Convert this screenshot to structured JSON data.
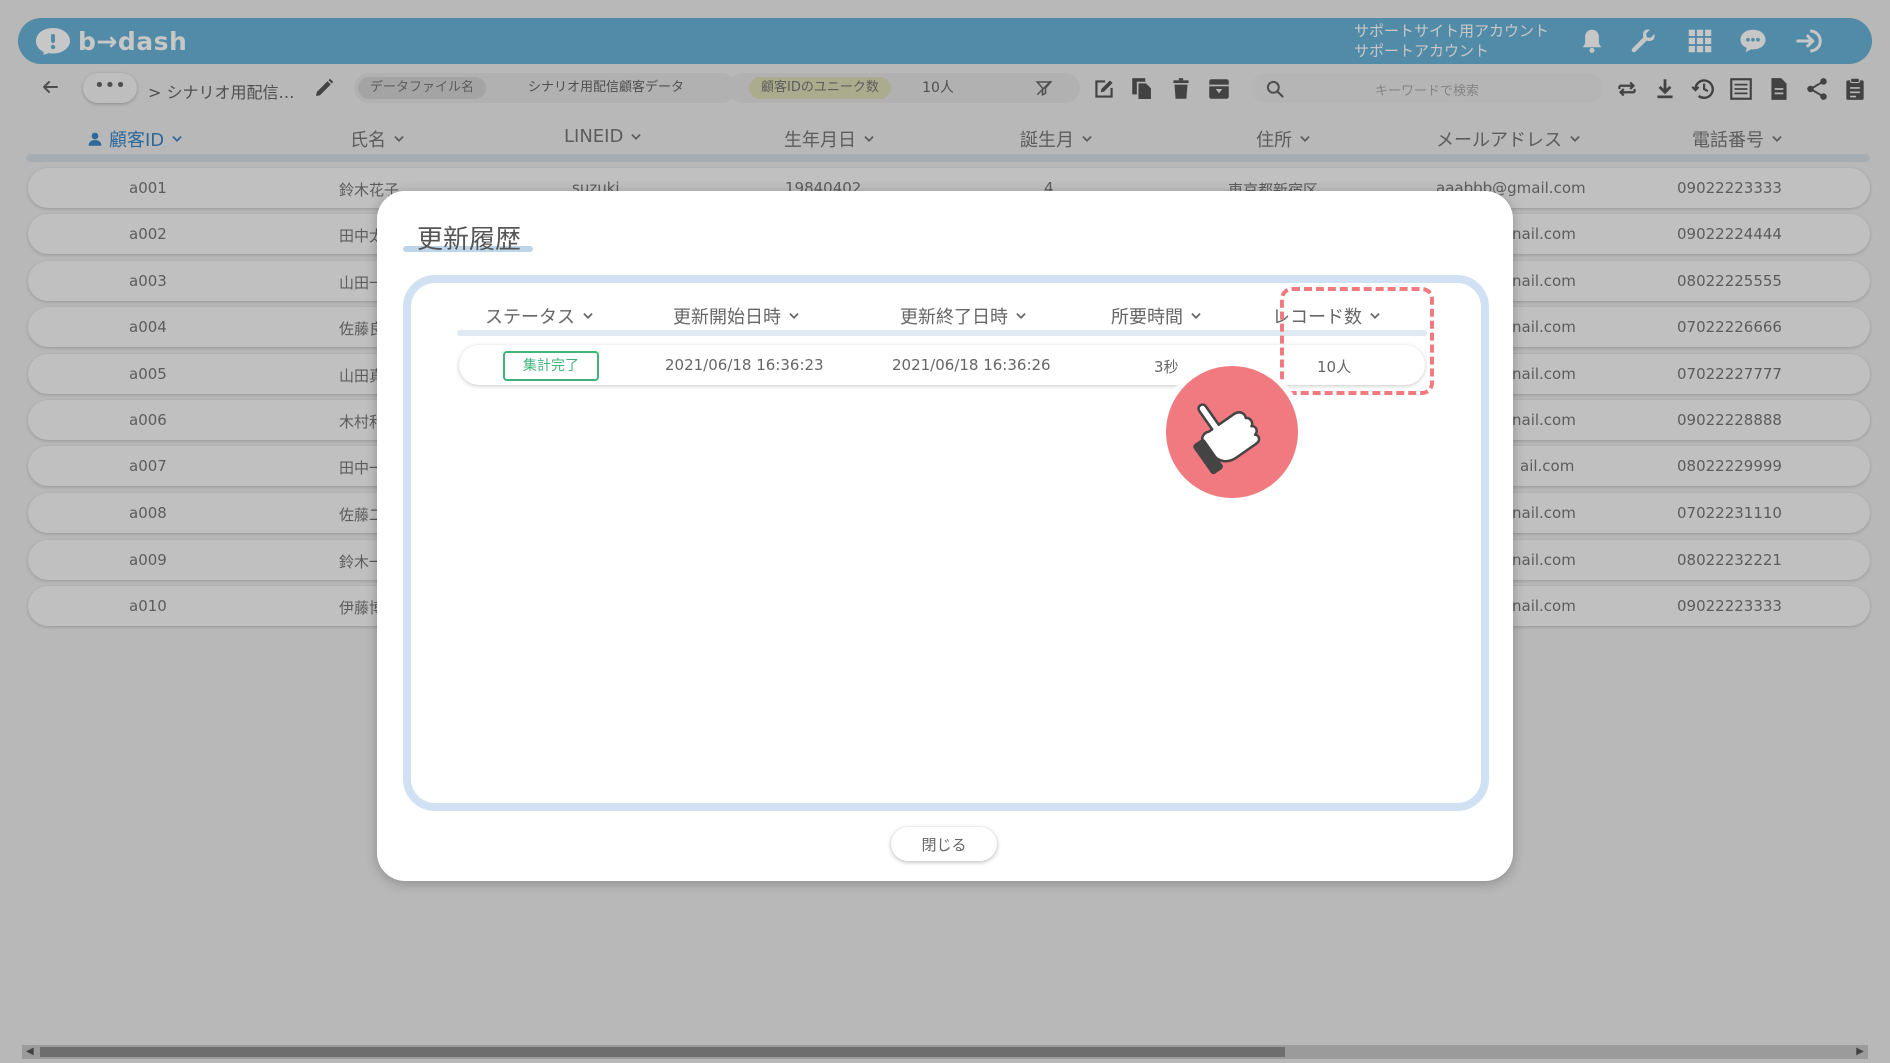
{
  "app": {
    "logo_text": "b→dash",
    "account_line1": "サポートサイト用アカウント",
    "account_line2": "サポートアカウント"
  },
  "toolbar": {
    "more_label": "•••",
    "breadcrumb": "> シナリオ用配信…",
    "data_file_label": "データファイル名",
    "data_file_value": "シナリオ用配信顧客データ",
    "unique_label": "顧客IDのユニーク数",
    "unique_value": "10人",
    "search_placeholder": "キーワードで検索"
  },
  "table": {
    "columns": [
      "顧客ID",
      "氏名",
      "LINEID",
      "生年月日",
      "誕生月",
      "住所",
      "メールアドレス",
      "電話番号"
    ],
    "first_row": {
      "birthday": "19840402",
      "line_id": "suzuki",
      "birth_month": "4",
      "address": "東京都新宿区",
      "email_full": "aaabbb@gmail.com"
    },
    "rows": [
      {
        "id": "a001",
        "name": "鈴木花子",
        "email": "aaabbb@gmail.com",
        "phone": "09022223333"
      },
      {
        "id": "a002",
        "name": "田中太",
        "email": "nail.com",
        "phone": "09022224444"
      },
      {
        "id": "a003",
        "name": "山田一",
        "email": "nail.com",
        "phone": "08022225555"
      },
      {
        "id": "a004",
        "name": "佐藤良",
        "email": "nail.com",
        "phone": "07022226666"
      },
      {
        "id": "a005",
        "name": "山田真",
        "email": "nail.com",
        "phone": "07022227777"
      },
      {
        "id": "a006",
        "name": "木村和",
        "email": "nail.com",
        "phone": "09022228888"
      },
      {
        "id": "a007",
        "name": "田中一",
        "email": "ail.com",
        "phone": "08022229999"
      },
      {
        "id": "a008",
        "name": "佐藤二",
        "email": "nail.com",
        "phone": "07022231110"
      },
      {
        "id": "a009",
        "name": "鈴木一",
        "email": "nail.com",
        "phone": "08022232221"
      },
      {
        "id": "a010",
        "name": "伊藤博",
        "email": "nail.com",
        "phone": "09022223333"
      }
    ]
  },
  "modal": {
    "title": "更新履歴",
    "columns": [
      "ステータス",
      "更新開始日時",
      "更新終了日時",
      "所要時間",
      "レコード数"
    ],
    "row": {
      "status": "集計完了",
      "start": "2021/06/18 16:36:23",
      "end": "2021/06/18 16:36:26",
      "duration": "3秒",
      "records": "10人"
    },
    "close_label": "閉じる"
  },
  "colors": {
    "brand": "#6ab3d6",
    "active_column": "#3d86c6",
    "status_green": "#3fb57a",
    "highlight": "#f07a80"
  },
  "icons": [
    "bell-icon",
    "wrench-icon",
    "apps-grid-icon",
    "support-chat-icon",
    "logout-icon",
    "back-arrow-icon",
    "pencil-icon",
    "filter-clear-icon",
    "edit-icon",
    "copy-icon",
    "trash-icon",
    "archive-icon",
    "search-icon",
    "refresh-icon",
    "download-icon",
    "history-icon",
    "list-icon",
    "document-icon",
    "share-icon",
    "clipboard-icon",
    "pointing-hand-icon"
  ]
}
